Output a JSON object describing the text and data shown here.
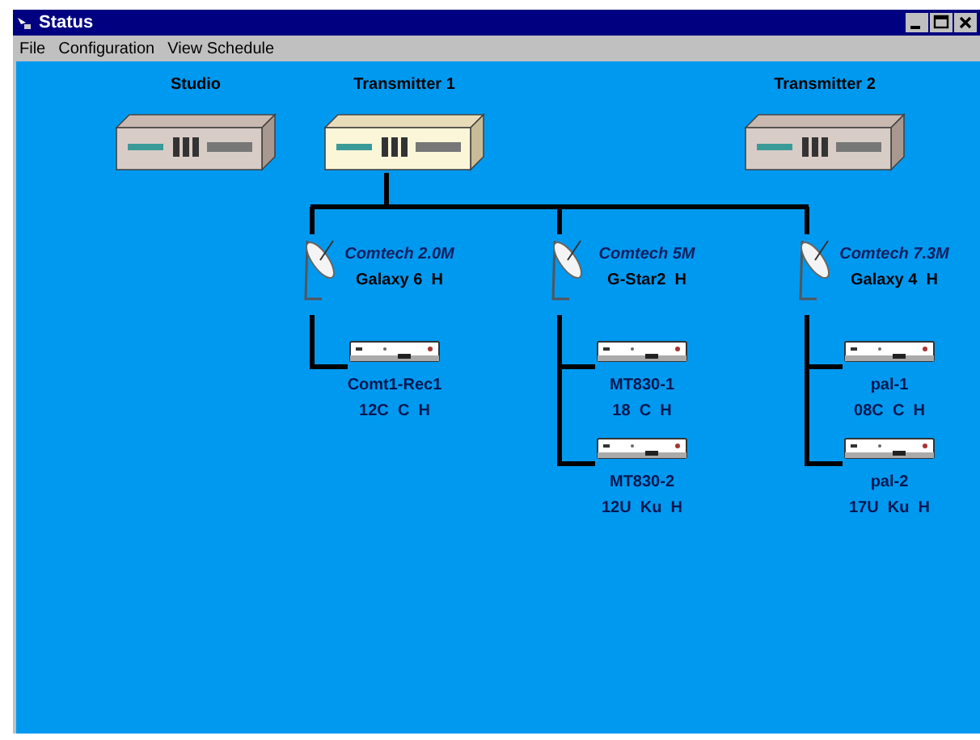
{
  "window": {
    "title": "Status"
  },
  "menu": [
    "File",
    "Configuration",
    "View Schedule"
  ],
  "sites": [
    {
      "name": "Studio",
      "selected": false
    },
    {
      "name": "Transmitter 1",
      "selected": true
    },
    {
      "name": "Transmitter 2",
      "selected": false
    }
  ],
  "uplinks": [
    {
      "antenna": "Comtech 2.0M",
      "satellite": "Galaxy 6  H",
      "receivers": [
        {
          "name": "Comt1-Rec1",
          "info": "12C  C  H"
        }
      ]
    },
    {
      "antenna": "Comtech 5M",
      "satellite": "G-Star2  H",
      "receivers": [
        {
          "name": "MT830-1",
          "info": "18  C  H"
        },
        {
          "name": "MT830-2",
          "info": "12U  Ku  H"
        }
      ]
    },
    {
      "antenna": "Comtech 7.3M",
      "satellite": "Galaxy 4  H",
      "receivers": [
        {
          "name": "pal-1",
          "info": "08C  C  H"
        },
        {
          "name": "pal-2",
          "info": "17U  Ku  H"
        }
      ]
    }
  ]
}
